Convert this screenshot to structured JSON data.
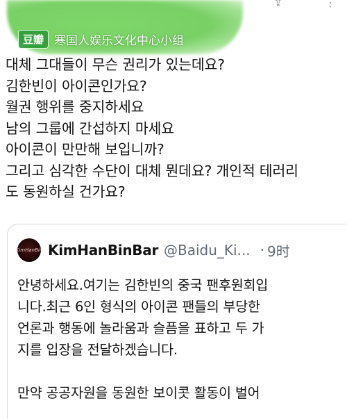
{
  "watermark": {
    "logo": "豆瓣",
    "text": "寒国人娱乐文化中心小组"
  },
  "tweet": {
    "lines": [
      "대체 그대들이 무슨 권리가 있는데요?",
      "김한빈이 아이콘인가요?",
      "월권 행위를 중지하세요",
      "남의 그룹에 간섭하지 마세요",
      "아이콘이 만만해 보입니까?",
      "그리고 심각한 수단이 대체 뭔데요? 개인적 테러리",
      "도 동원하실 건가요?"
    ]
  },
  "quote": {
    "avatar_text": "KimHanBin",
    "name": "KimHanBinBar",
    "handle": "@Baidu_Ki...",
    "dot": "·",
    "time": "9时",
    "paragraph1": [
      "안녕하세요.여기는 김한빈의 중국 팬후원회입",
      "니다.최근 6인 형식의 아이콘 팬들의 부당한",
      "언론과 행동에 놀라움과 슬픔을 표하고 두 가",
      "지를 입장을 전달하겠습니다."
    ],
    "paragraph2": [
      "만약 공공자원을 동원한 보이콧 활동이 벌어"
    ]
  }
}
